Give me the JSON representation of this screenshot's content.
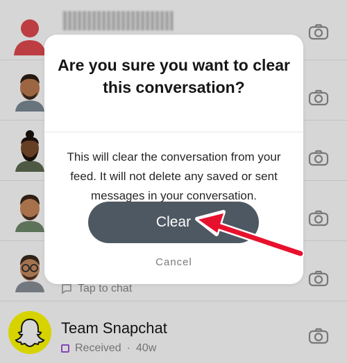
{
  "chat_list": {
    "rows": [
      {
        "title": "",
        "subtitle": ""
      },
      {
        "title": "",
        "subtitle": ""
      },
      {
        "title": "",
        "subtitle": ""
      },
      {
        "title": "",
        "subtitle": ""
      },
      {
        "title": "",
        "subtitle": "Tap to chat"
      },
      {
        "title": "Team Snapchat",
        "status": "Received",
        "separator": "·",
        "age": "40w"
      }
    ]
  },
  "dialog": {
    "title": "Are you sure you want to clear this conversation?",
    "body": "This will clear the conversation from your feed. It will not delete any saved or sent messages in your conversation.",
    "confirm_label": "Clear",
    "cancel_label": "Cancel"
  },
  "colors": {
    "button_bg": "#4e5862",
    "arrow": "#e8112d",
    "snapchat_yellow": "#fffc00",
    "received_purple": "#9b55d9"
  },
  "icons": [
    "camera-icon",
    "ghost-icon",
    "chat-bubble-icon",
    "arrow-icon"
  ]
}
